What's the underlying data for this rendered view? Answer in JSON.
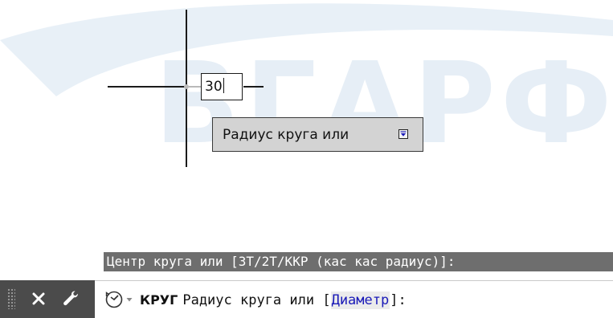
{
  "watermark": {
    "text": "ВГАРФ"
  },
  "drawing": {
    "dynamic_input_value": "30",
    "tooltip": {
      "label": "Радиус круга или",
      "options_icon": "down-arrow-box-icon"
    }
  },
  "history": {
    "text": "Центр круга или [3Т/2Т/ККР (кас кас радиус)]:"
  },
  "command_line": {
    "tools": {
      "close_icon": "close-icon",
      "settings_icon": "wrench-icon"
    },
    "recent_icon": "recent-commands-icon",
    "command_name": "КРУГ",
    "prompt_before": "Радиус круга или [",
    "option": "Диаметр",
    "prompt_after": "]:"
  },
  "colors": {
    "option_text": "#1a1ab8",
    "history_bg": "#6e6e6e",
    "tools_bg": "#4b4b4b",
    "tooltip_bg": "#d3d3d3",
    "watermark": "#e6eef6"
  }
}
